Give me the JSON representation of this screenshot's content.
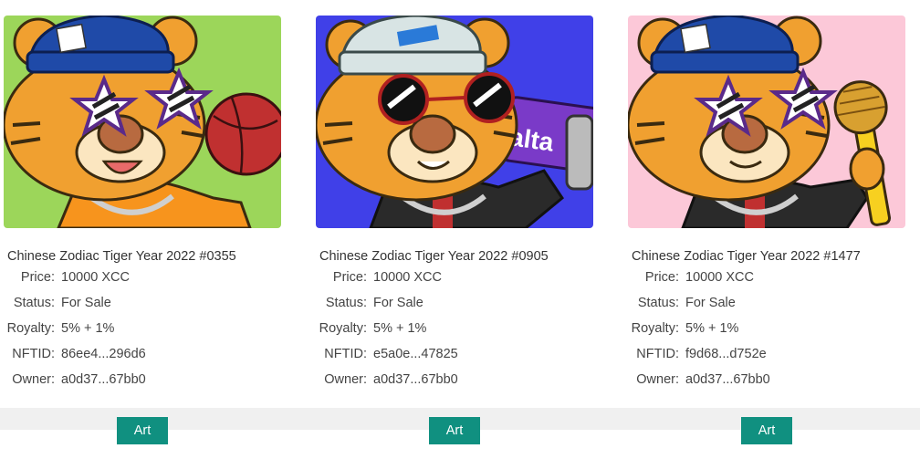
{
  "cards": [
    {
      "title": "Chinese Zodiac Tiger Year 2022 #0355",
      "bg_color": "#9cd65a",
      "hat_color": "#1f4aa8",
      "glasses": "stars",
      "prop": "basketball",
      "fields": [
        {
          "label": "Price:",
          "value": "10000 XCC"
        },
        {
          "label": "Status:",
          "value": "For Sale"
        },
        {
          "label": "Royalty:",
          "value": "5% + 1%"
        },
        {
          "label": "NFTID:",
          "value": "86ee4...296d6"
        },
        {
          "label": "Owner:",
          "value": "a0d37...67bb0"
        }
      ],
      "button_label": "Art"
    },
    {
      "title": "Chinese Zodiac Tiger Year 2022 #0905",
      "bg_color": "#4040e8",
      "hat_color": "#d8e4e4",
      "glasses": "round",
      "prop": "skateboard",
      "prop_text": "alta",
      "fields": [
        {
          "label": "Price:",
          "value": "10000 XCC"
        },
        {
          "label": "Status:",
          "value": "For Sale"
        },
        {
          "label": "Royalty:",
          "value": "5% + 1%"
        },
        {
          "label": "NFTID:",
          "value": "e5a0e...47825"
        },
        {
          "label": "Owner:",
          "value": "a0d37...67bb0"
        }
      ],
      "button_label": "Art"
    },
    {
      "title": "Chinese Zodiac Tiger Year 2022 #1477",
      "bg_color": "#fcc8d8",
      "hat_color": "#1f4aa8",
      "glasses": "stars",
      "prop": "microphone",
      "fields": [
        {
          "label": "Price:",
          "value": "10000 XCC"
        },
        {
          "label": "Status:",
          "value": "For Sale"
        },
        {
          "label": "Royalty:",
          "value": "5% + 1%"
        },
        {
          "label": "NFTID:",
          "value": "f9d68...d752e"
        },
        {
          "label": "Owner:",
          "value": "a0d37...67bb0"
        }
      ],
      "button_label": "Art"
    }
  ],
  "colors": {
    "accent": "#109080",
    "footer_bg": "#f0f0f0",
    "tiger_fur": "#f0a030"
  }
}
